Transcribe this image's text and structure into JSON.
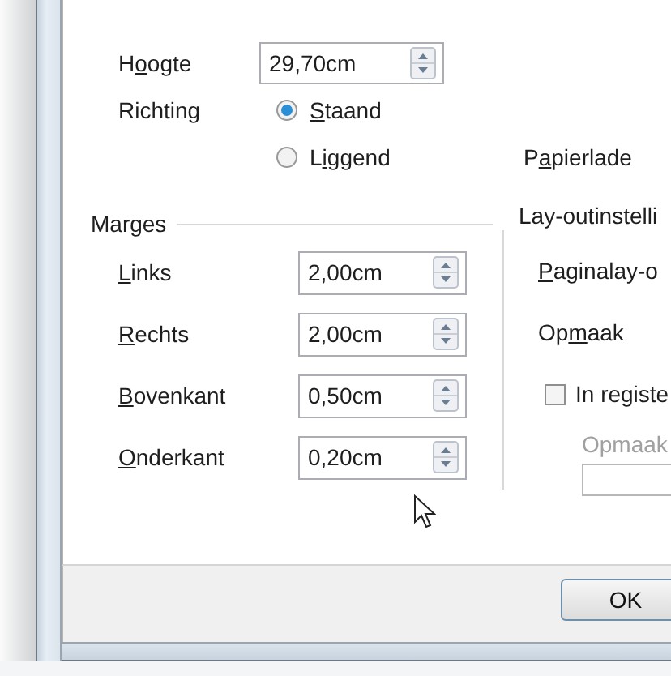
{
  "height_field": {
    "label": {
      "before": "H",
      "key": "o",
      "after": "ogte"
    },
    "value": "29,70cm"
  },
  "orientation": {
    "label": "Richting",
    "options": [
      {
        "label": {
          "key": "S",
          "after": "taand"
        },
        "selected": true
      },
      {
        "label": {
          "before": "L",
          "key": "i",
          "after": "ggend"
        },
        "selected": false
      }
    ]
  },
  "paper_tray": {
    "label": {
      "before": "P",
      "key": "a",
      "after": "pierlade"
    }
  },
  "margins": {
    "title": "Marges",
    "rows": [
      {
        "label": {
          "key": "L",
          "after": "inks"
        },
        "value": "2,00cm"
      },
      {
        "label": {
          "key": "R",
          "after": "echts"
        },
        "value": "2,00cm"
      },
      {
        "label": {
          "key": "B",
          "after": "ovenkant"
        },
        "value": "0,50cm"
      },
      {
        "label": {
          "key": "O",
          "after": "nderkant"
        },
        "value": "0,20cm"
      }
    ]
  },
  "layout_settings": {
    "title": "Lay-outinstelli",
    "page_layout": {
      "label": {
        "key": "P",
        "after": "aginalay-o"
      }
    },
    "format": {
      "label": {
        "before": "Op",
        "key": "m",
        "after": "aak"
      }
    },
    "register": {
      "label": "In registe",
      "checked": false
    },
    "register_style": {
      "label": "Opmaak",
      "disabled": true
    }
  },
  "buttons": [
    {
      "label": "OK"
    }
  ]
}
